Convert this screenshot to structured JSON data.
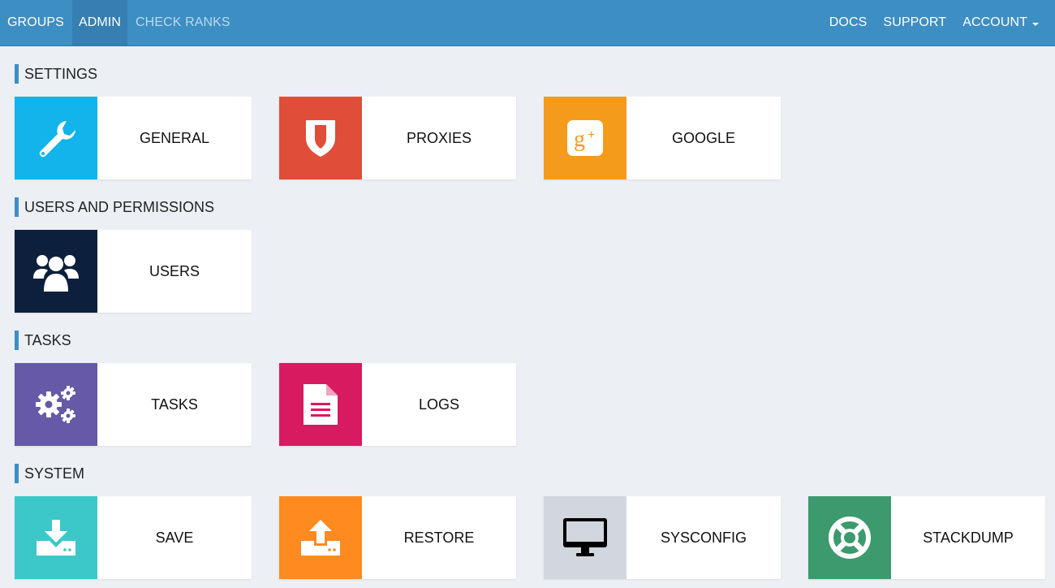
{
  "nav": {
    "left": [
      {
        "label": "GROUPS"
      },
      {
        "label": "ADMIN"
      },
      {
        "label": "CHECK RANKS"
      }
    ],
    "right": [
      {
        "label": "DOCS"
      },
      {
        "label": "SUPPORT"
      },
      {
        "label": "ACCOUNT"
      }
    ]
  },
  "sections": {
    "settings": {
      "title": "SETTINGS",
      "cards": [
        {
          "label": "GENERAL",
          "icon": "wrench-icon",
          "color": "#12b4eb"
        },
        {
          "label": "PROXIES",
          "icon": "shield-icon",
          "color": "#e04d38"
        },
        {
          "label": "GOOGLE",
          "icon": "google-plus-icon",
          "color": "#f59b1c"
        }
      ]
    },
    "users": {
      "title": "USERS AND PERMISSIONS",
      "cards": [
        {
          "label": "USERS",
          "icon": "users-icon",
          "color": "#0c1f3d"
        }
      ]
    },
    "tasks": {
      "title": "TASKS",
      "cards": [
        {
          "label": "TASKS",
          "icon": "gears-icon",
          "color": "#6559a8"
        },
        {
          "label": "LOGS",
          "icon": "document-icon",
          "color": "#d81b60"
        }
      ]
    },
    "system": {
      "title": "SYSTEM",
      "cards": [
        {
          "label": "SAVE",
          "icon": "download-icon",
          "color": "#3cc8c8"
        },
        {
          "label": "RESTORE",
          "icon": "upload-icon",
          "color": "#ff8a1f"
        },
        {
          "label": "SYSCONFIG",
          "icon": "monitor-icon",
          "color": "#d2d6de"
        },
        {
          "label": "STACKDUMP",
          "icon": "lifebuoy-icon",
          "color": "#3c9a6e"
        }
      ]
    }
  }
}
